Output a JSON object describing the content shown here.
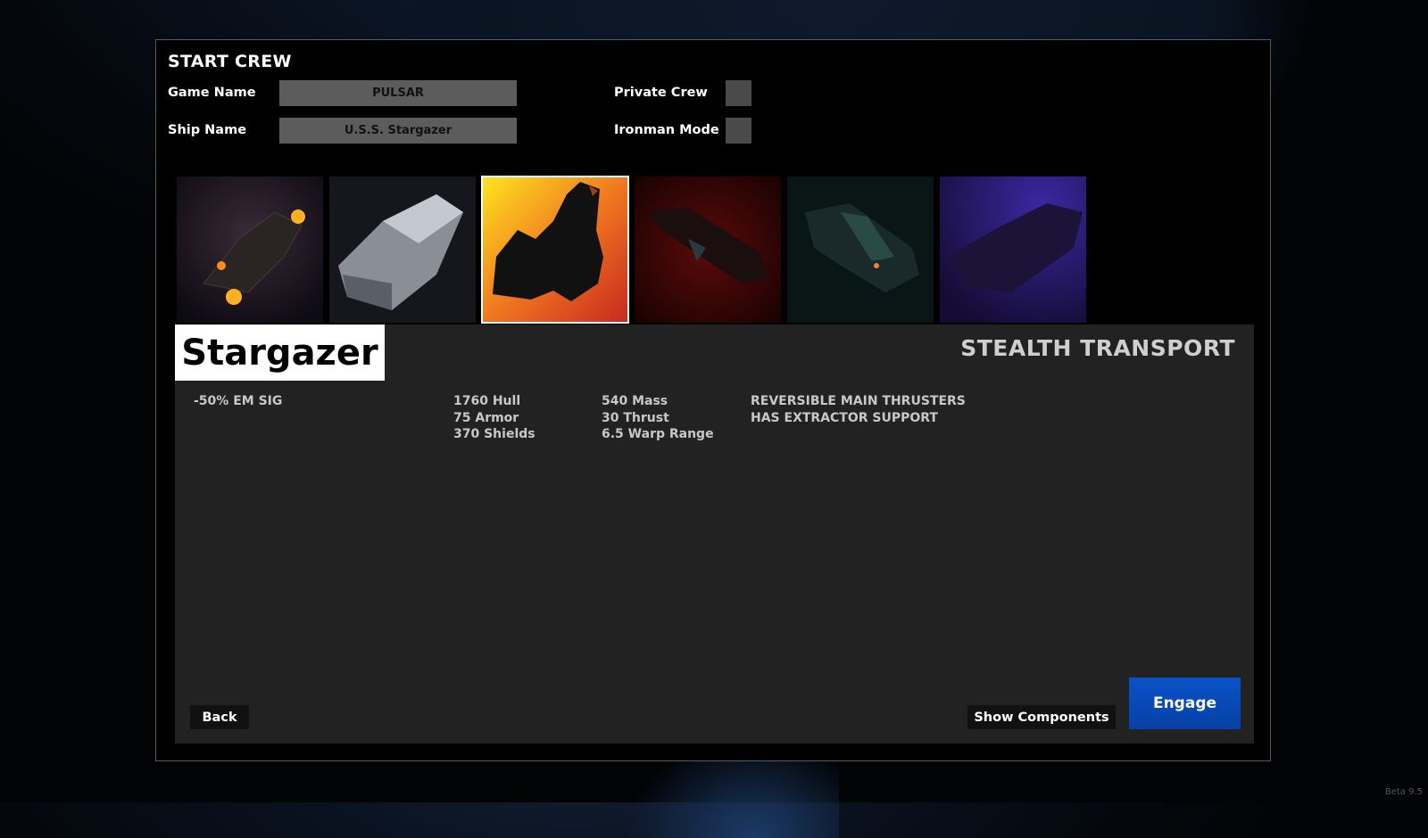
{
  "screen": {
    "title": "START CREW",
    "version": "Beta 9.5"
  },
  "form": {
    "game_name_label": "Game Name",
    "game_name_value": "PULSAR",
    "ship_name_label": "Ship Name",
    "ship_name_value": "U.S.S. Stargazer",
    "private_crew_label": "Private Crew",
    "private_crew_checked": false,
    "ironman_label": "Ironman Mode",
    "ironman_checked": false
  },
  "ships": [
    {
      "name": "ship-1",
      "bg": "#1a1420",
      "selected": false
    },
    {
      "name": "ship-2",
      "bg": "#14161c",
      "selected": false
    },
    {
      "name": "ship-3",
      "bg": "#f07a20",
      "selected": true
    },
    {
      "name": "ship-4",
      "bg": "#3a0808",
      "selected": false
    },
    {
      "name": "ship-5",
      "bg": "#0a1a1a",
      "selected": false
    },
    {
      "name": "ship-6",
      "bg": "#1e1448",
      "selected": false
    }
  ],
  "selected_ship": {
    "name": "Stargazer",
    "type": "STEALTH TRANSPORT",
    "col1": [
      "-50% EM SIG"
    ],
    "col2": [
      "1760 Hull",
      "75 Armor",
      "370 Shields"
    ],
    "col3": [
      "540 Mass",
      "30 Thrust",
      "6.5 Warp Range"
    ],
    "col4": [
      "REVERSIBLE MAIN THRUSTERS",
      "HAS EXTRACTOR SUPPORT"
    ]
  },
  "buttons": {
    "back": "Back",
    "show_components": "Show Components",
    "engage": "Engage"
  },
  "colors": {
    "engage": "#0a52c8",
    "field": "#5c5c5c",
    "info_bg": "#222222"
  }
}
